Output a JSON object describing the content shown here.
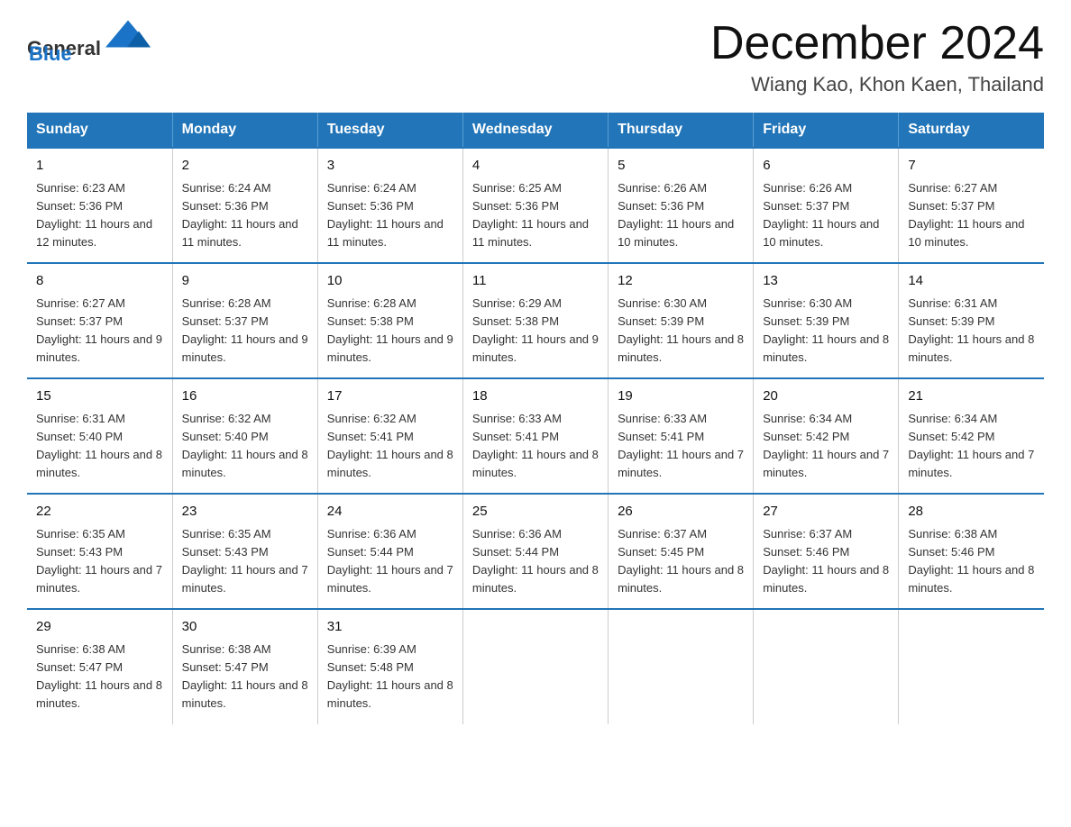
{
  "header": {
    "logo_general": "General",
    "logo_blue": "Blue",
    "month_title": "December 2024",
    "location": "Wiang Kao, Khon Kaen, Thailand"
  },
  "days_of_week": [
    "Sunday",
    "Monday",
    "Tuesday",
    "Wednesday",
    "Thursday",
    "Friday",
    "Saturday"
  ],
  "weeks": [
    [
      {
        "day": "1",
        "sunrise": "6:23 AM",
        "sunset": "5:36 PM",
        "daylight": "11 hours and 12 minutes."
      },
      {
        "day": "2",
        "sunrise": "6:24 AM",
        "sunset": "5:36 PM",
        "daylight": "11 hours and 11 minutes."
      },
      {
        "day": "3",
        "sunrise": "6:24 AM",
        "sunset": "5:36 PM",
        "daylight": "11 hours and 11 minutes."
      },
      {
        "day": "4",
        "sunrise": "6:25 AM",
        "sunset": "5:36 PM",
        "daylight": "11 hours and 11 minutes."
      },
      {
        "day": "5",
        "sunrise": "6:26 AM",
        "sunset": "5:36 PM",
        "daylight": "11 hours and 10 minutes."
      },
      {
        "day": "6",
        "sunrise": "6:26 AM",
        "sunset": "5:37 PM",
        "daylight": "11 hours and 10 minutes."
      },
      {
        "day": "7",
        "sunrise": "6:27 AM",
        "sunset": "5:37 PM",
        "daylight": "11 hours and 10 minutes."
      }
    ],
    [
      {
        "day": "8",
        "sunrise": "6:27 AM",
        "sunset": "5:37 PM",
        "daylight": "11 hours and 9 minutes."
      },
      {
        "day": "9",
        "sunrise": "6:28 AM",
        "sunset": "5:37 PM",
        "daylight": "11 hours and 9 minutes."
      },
      {
        "day": "10",
        "sunrise": "6:28 AM",
        "sunset": "5:38 PM",
        "daylight": "11 hours and 9 minutes."
      },
      {
        "day": "11",
        "sunrise": "6:29 AM",
        "sunset": "5:38 PM",
        "daylight": "11 hours and 9 minutes."
      },
      {
        "day": "12",
        "sunrise": "6:30 AM",
        "sunset": "5:39 PM",
        "daylight": "11 hours and 8 minutes."
      },
      {
        "day": "13",
        "sunrise": "6:30 AM",
        "sunset": "5:39 PM",
        "daylight": "11 hours and 8 minutes."
      },
      {
        "day": "14",
        "sunrise": "6:31 AM",
        "sunset": "5:39 PM",
        "daylight": "11 hours and 8 minutes."
      }
    ],
    [
      {
        "day": "15",
        "sunrise": "6:31 AM",
        "sunset": "5:40 PM",
        "daylight": "11 hours and 8 minutes."
      },
      {
        "day": "16",
        "sunrise": "6:32 AM",
        "sunset": "5:40 PM",
        "daylight": "11 hours and 8 minutes."
      },
      {
        "day": "17",
        "sunrise": "6:32 AM",
        "sunset": "5:41 PM",
        "daylight": "11 hours and 8 minutes."
      },
      {
        "day": "18",
        "sunrise": "6:33 AM",
        "sunset": "5:41 PM",
        "daylight": "11 hours and 8 minutes."
      },
      {
        "day": "19",
        "sunrise": "6:33 AM",
        "sunset": "5:41 PM",
        "daylight": "11 hours and 7 minutes."
      },
      {
        "day": "20",
        "sunrise": "6:34 AM",
        "sunset": "5:42 PM",
        "daylight": "11 hours and 7 minutes."
      },
      {
        "day": "21",
        "sunrise": "6:34 AM",
        "sunset": "5:42 PM",
        "daylight": "11 hours and 7 minutes."
      }
    ],
    [
      {
        "day": "22",
        "sunrise": "6:35 AM",
        "sunset": "5:43 PM",
        "daylight": "11 hours and 7 minutes."
      },
      {
        "day": "23",
        "sunrise": "6:35 AM",
        "sunset": "5:43 PM",
        "daylight": "11 hours and 7 minutes."
      },
      {
        "day": "24",
        "sunrise": "6:36 AM",
        "sunset": "5:44 PM",
        "daylight": "11 hours and 7 minutes."
      },
      {
        "day": "25",
        "sunrise": "6:36 AM",
        "sunset": "5:44 PM",
        "daylight": "11 hours and 8 minutes."
      },
      {
        "day": "26",
        "sunrise": "6:37 AM",
        "sunset": "5:45 PM",
        "daylight": "11 hours and 8 minutes."
      },
      {
        "day": "27",
        "sunrise": "6:37 AM",
        "sunset": "5:46 PM",
        "daylight": "11 hours and 8 minutes."
      },
      {
        "day": "28",
        "sunrise": "6:38 AM",
        "sunset": "5:46 PM",
        "daylight": "11 hours and 8 minutes."
      }
    ],
    [
      {
        "day": "29",
        "sunrise": "6:38 AM",
        "sunset": "5:47 PM",
        "daylight": "11 hours and 8 minutes."
      },
      {
        "day": "30",
        "sunrise": "6:38 AM",
        "sunset": "5:47 PM",
        "daylight": "11 hours and 8 minutes."
      },
      {
        "day": "31",
        "sunrise": "6:39 AM",
        "sunset": "5:48 PM",
        "daylight": "11 hours and 8 minutes."
      },
      null,
      null,
      null,
      null
    ]
  ],
  "labels": {
    "sunrise": "Sunrise:",
    "sunset": "Sunset:",
    "daylight": "Daylight:"
  }
}
